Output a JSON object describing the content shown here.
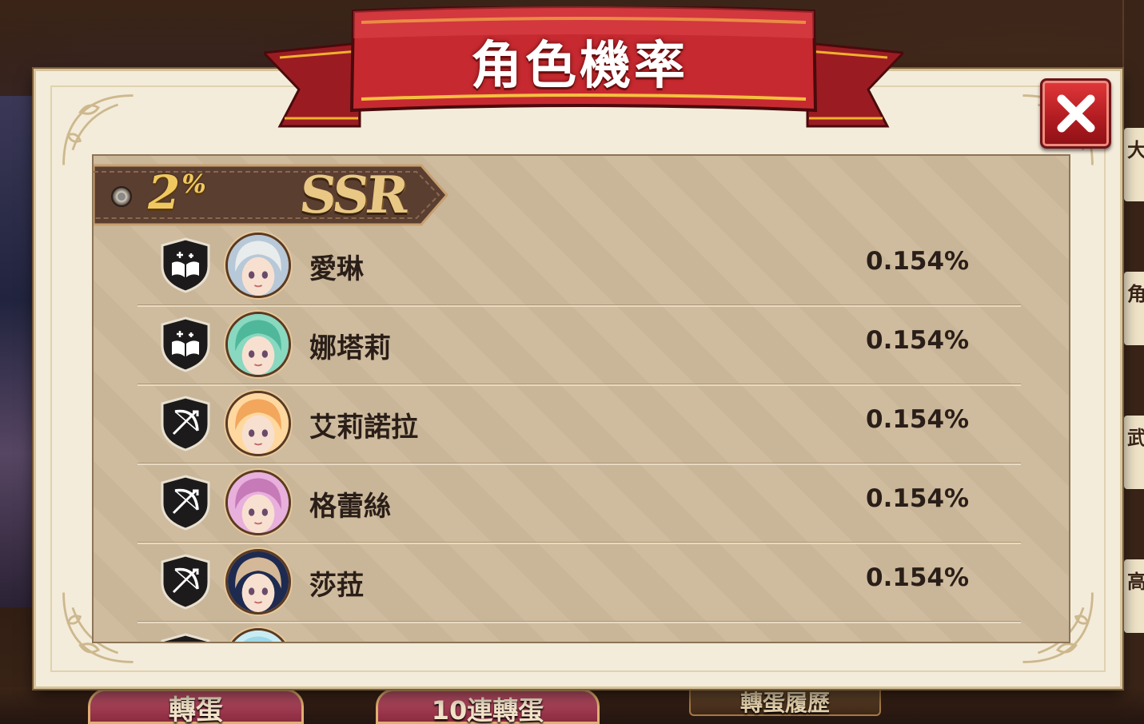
{
  "dialog": {
    "title": "角色機率"
  },
  "tier": {
    "percent": "2",
    "percent_sign": "%",
    "rank": "SSR"
  },
  "characters": [
    {
      "name": "愛琳",
      "rate": "0.154%",
      "class_icon": "mage-book-icon",
      "hair": "#e8ecec",
      "accent": "#b7c8d8"
    },
    {
      "name": "娜塔莉",
      "rate": "0.154%",
      "class_icon": "mage-book-icon",
      "hair": "#4fb89a",
      "accent": "#89d8c0"
    },
    {
      "name": "艾莉諾拉",
      "rate": "0.154%",
      "class_icon": "archer-bow-icon",
      "hair": "#f2a75c",
      "accent": "#ffd8a0"
    },
    {
      "name": "格蕾絲",
      "rate": "0.154%",
      "class_icon": "archer-bow-icon",
      "hair": "#c67ab8",
      "accent": "#e8b0dc"
    },
    {
      "name": "莎菈",
      "rate": "0.154%",
      "class_icon": "archer-bow-icon",
      "hair": "#d4b898",
      "accent": "#1e2a50"
    },
    {
      "name": "",
      "rate": "",
      "class_icon": "mage-book-icon",
      "hair": "#9cd8e8",
      "accent": "#c8ecf4"
    }
  ],
  "background": {
    "bottom_buttons": [
      "轉蛋",
      "10連轉蛋",
      "轉蛋履歷"
    ],
    "right_tabs": [
      "大",
      "角色",
      "武器",
      "高級"
    ]
  },
  "colors": {
    "ribbon_red": "#b8232a",
    "panel_cream": "#f4ecda",
    "list_tan": "#cdb99b",
    "text_dark": "#2a1e18"
  }
}
